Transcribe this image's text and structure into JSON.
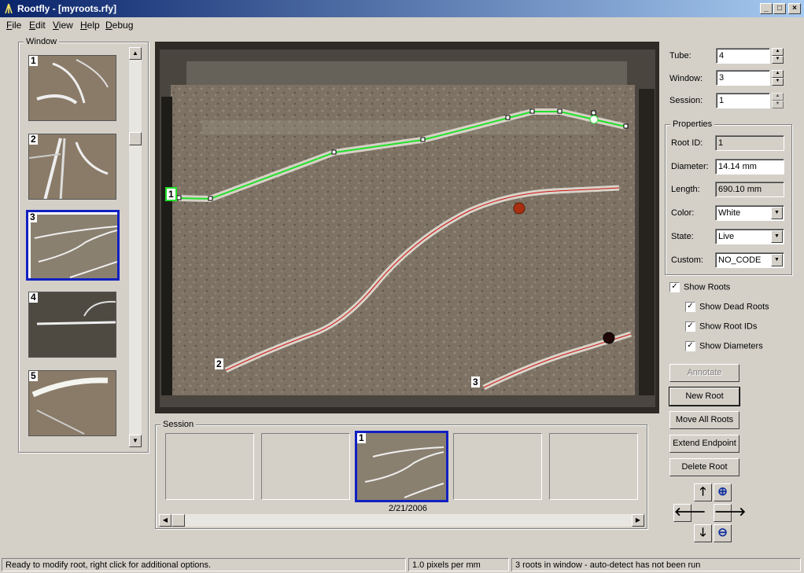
{
  "window": {
    "title": "Rootfly - [myroots.rfy]",
    "minimize": "_",
    "maximize": "□",
    "close": "×"
  },
  "menu": [
    {
      "label": "File"
    },
    {
      "label": "Edit"
    },
    {
      "label": "View"
    },
    {
      "label": "Help"
    },
    {
      "label": "Debug"
    }
  ],
  "window_panel": {
    "legend": "Window",
    "thumbnails": [
      {
        "number": "1",
        "selected": false
      },
      {
        "number": "2",
        "selected": false
      },
      {
        "number": "3",
        "selected": true
      },
      {
        "number": "4",
        "selected": false
      },
      {
        "number": "5",
        "selected": false
      }
    ]
  },
  "image_view": {
    "roots": [
      {
        "id": "1",
        "color": "#22e02a",
        "active": true
      },
      {
        "id": "2",
        "color": "#d01010",
        "active": false
      },
      {
        "id": "3",
        "color": "#d01010",
        "active": false
      }
    ]
  },
  "session_panel": {
    "legend": "Session",
    "frames": [
      {
        "number": "",
        "date": ""
      },
      {
        "number": "",
        "date": ""
      },
      {
        "number": "1",
        "date": "2/21/2006",
        "selected": true
      },
      {
        "number": "",
        "date": ""
      },
      {
        "number": "",
        "date": ""
      }
    ]
  },
  "nav": {
    "tube_label": "Tube:",
    "tube_value": "4",
    "window_label": "Window:",
    "window_value": "3",
    "session_label": "Session:",
    "session_value": "1"
  },
  "properties": {
    "legend": "Properties",
    "root_id_label": "Root ID:",
    "root_id_value": "1",
    "diameter_label": "Diameter:",
    "diameter_value": "14.14 mm",
    "length_label": "Length:",
    "length_value": "690.10 mm",
    "color_label": "Color:",
    "color_value": "White",
    "state_label": "State:",
    "state_value": "Live",
    "custom_label": "Custom:",
    "custom_value": "NO_CODE"
  },
  "options": {
    "show_roots": {
      "label": "Show Roots",
      "checked": true
    },
    "show_dead_roots": {
      "label": "Show Dead Roots",
      "checked": true
    },
    "show_root_ids": {
      "label": "Show Root IDs",
      "checked": true
    },
    "show_diameters": {
      "label": "Show Diameters",
      "checked": true
    }
  },
  "buttons": {
    "annotate": "Annotate",
    "new_root": "New Root",
    "move_all_roots": "Move All Roots",
    "extend_endpoint": "Extend Endpoint",
    "delete_root": "Delete Root"
  },
  "icons": {
    "up": "arrow-up-icon",
    "down": "arrow-down-icon",
    "left": "arrow-left-icon",
    "right": "arrow-right-icon",
    "zoom_in": "zoom-in-icon",
    "zoom_out": "zoom-out-icon"
  },
  "status": {
    "message": "Ready to modify root, right click for additional options.",
    "scale": "1.0 pixels per mm",
    "summary": "3 roots in window - auto-detect has not been run"
  }
}
